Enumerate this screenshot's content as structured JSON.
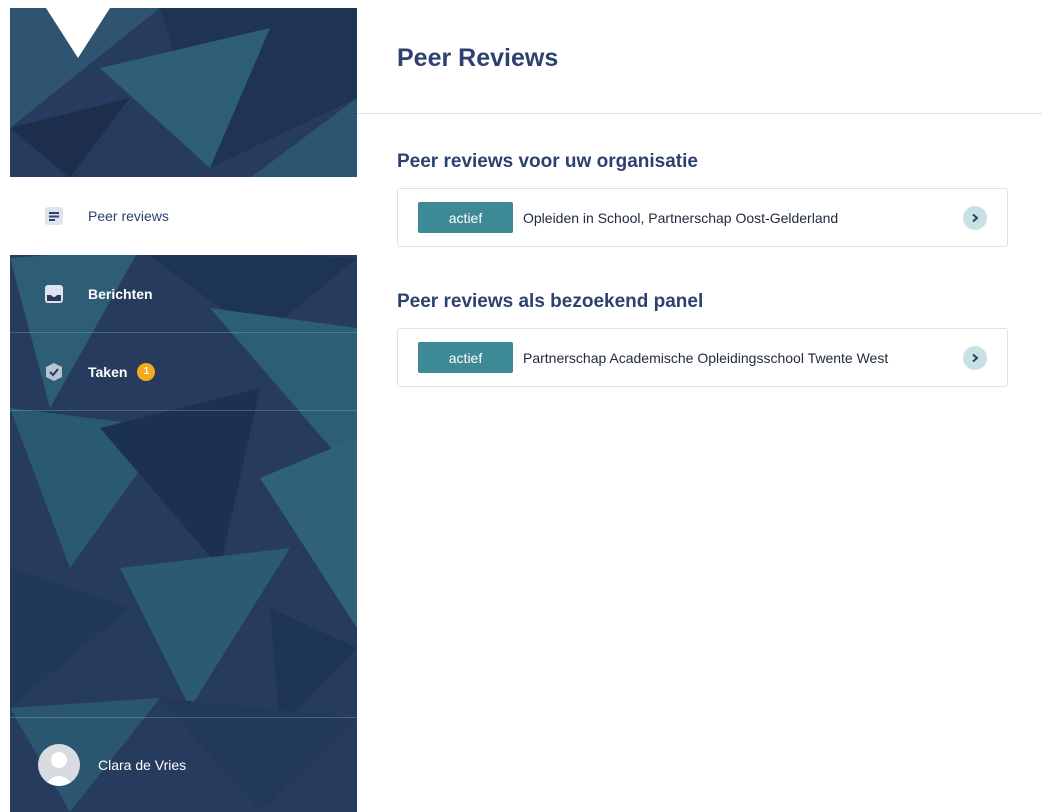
{
  "sidebar": {
    "items": [
      {
        "label": "Peer reviews",
        "icon": "document-lines-icon",
        "active": true
      },
      {
        "label": "Berichten",
        "icon": "inbox-icon",
        "active": false
      },
      {
        "label": "Taken",
        "icon": "shield-check-icon",
        "active": false,
        "badge": "1"
      }
    ],
    "user": {
      "name": "Clara de Vries",
      "icon": "user-avatar-icon"
    }
  },
  "main": {
    "title": "Peer Reviews",
    "sections": [
      {
        "title": "Peer reviews voor uw organisatie",
        "items": [
          {
            "status": "actief",
            "title": "Opleiden in School, Partnerschap Oost-Gelderland",
            "icon": "chevron-right-icon"
          }
        ]
      },
      {
        "title": "Peer reviews als bezoekend panel",
        "items": [
          {
            "status": "actief",
            "title": "Partnerschap Academische Opleidingsschool Twente West",
            "icon": "chevron-right-icon"
          }
        ]
      }
    ]
  },
  "colors": {
    "sidebar": "#263b5d",
    "accent": "#3d8a96",
    "heading": "#2d4170",
    "badge": "#f4a81d"
  }
}
